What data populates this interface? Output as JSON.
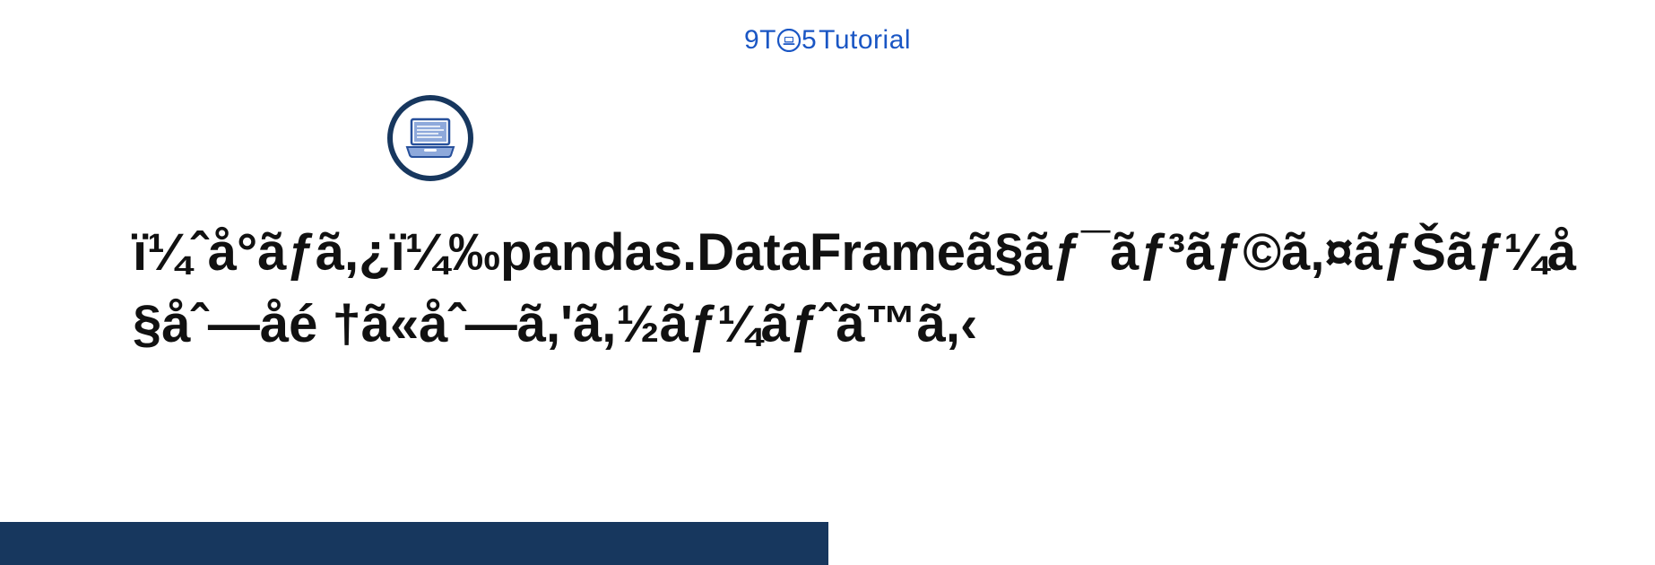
{
  "brand": {
    "prefix9": "9",
    "prefixT": "T",
    "oIcon": "laptop-circle-icon",
    "suffix5": "5",
    "tutorial": "Tutorial"
  },
  "article": {
    "title": "ï¼ˆå°ãƒã,¿ï¼‰pandas.DataFrameã§ãƒ¯ãƒ³ãƒ©ã,¤ãƒŠãƒ¼å§åˆ—åé †ã«åˆ—ã,'ã,½ãƒ¼ãƒˆã™ã,‹"
  },
  "colors": {
    "brandBlue": "#1a56c4",
    "darkNavy": "#17375e",
    "lightBlue": "#8ea9db"
  }
}
